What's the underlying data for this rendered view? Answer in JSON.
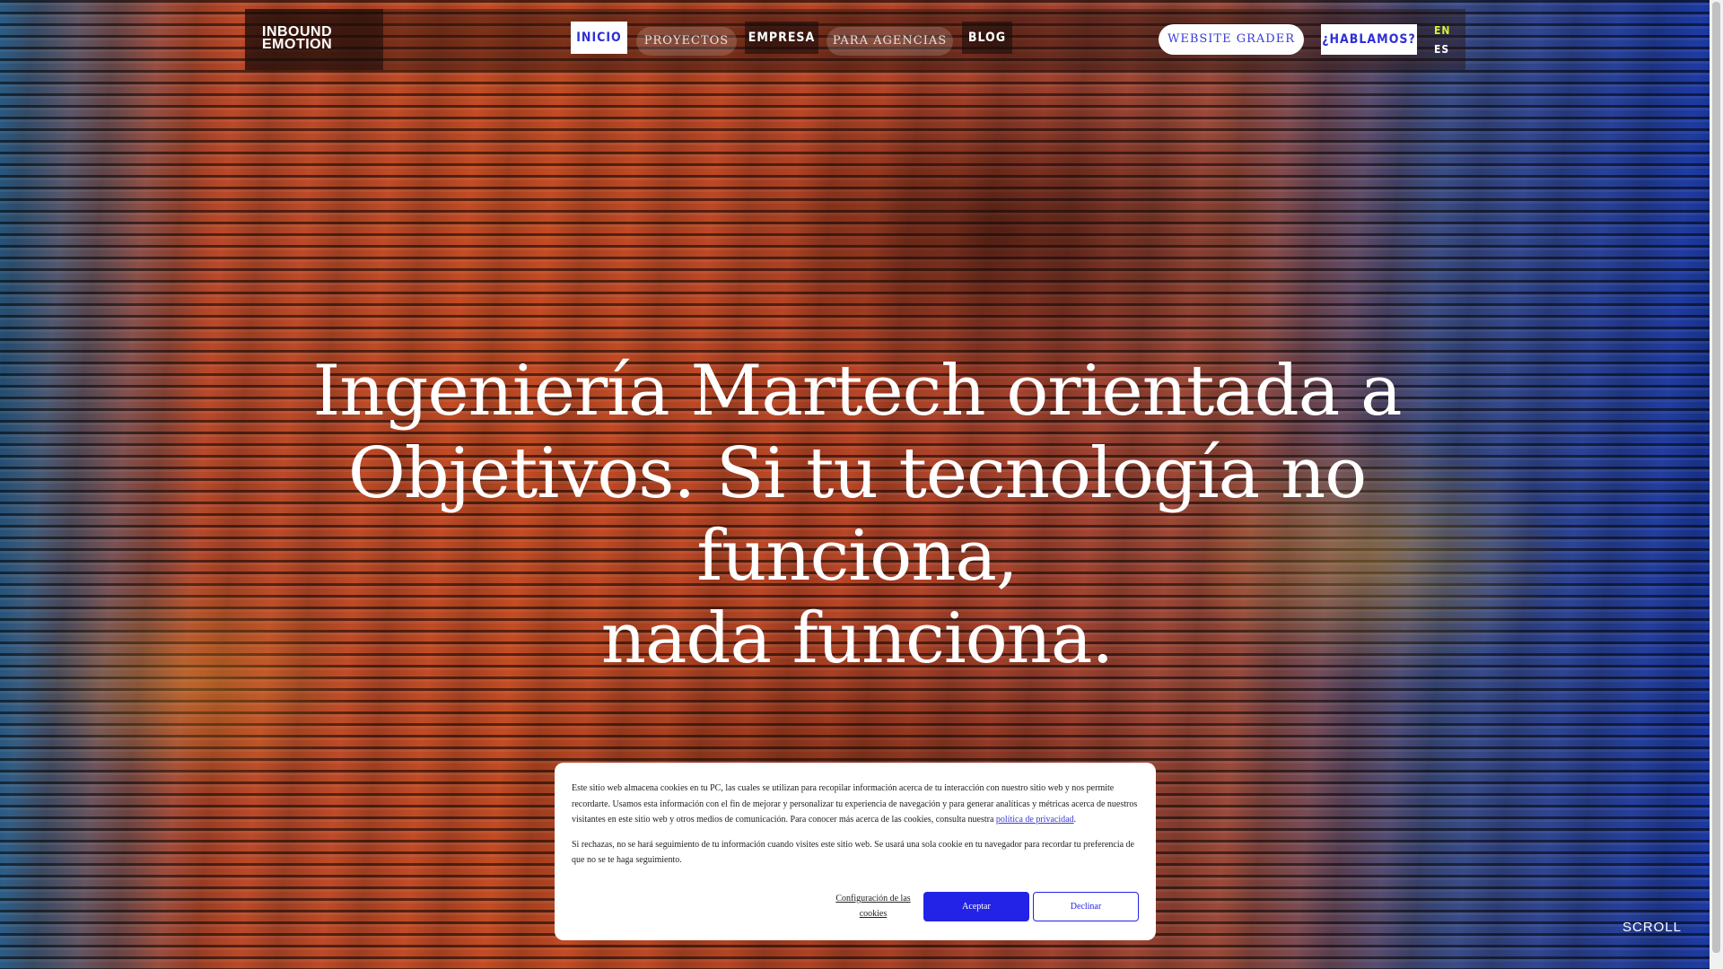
{
  "logo": {
    "line1": "INBOUND",
    "line2": "EMOTION"
  },
  "nav": {
    "items": [
      {
        "label": "INICIO"
      },
      {
        "label": "PROYECTOS"
      },
      {
        "label": "EMPRESA"
      },
      {
        "label": "PARA AGENCIAS"
      },
      {
        "label": "BLOG"
      }
    ],
    "grader_label": "WEBSITE GRADER",
    "contact_label": "¿HABLAMOS?",
    "lang_en": "EN",
    "lang_es": "ES"
  },
  "hero": {
    "line1": "Ingeniería Martech orientada a",
    "line2": "Objetivos. Si tu tecnología no funciona,",
    "line3": "nada funciona.",
    "scroll_label": "SCROLL"
  },
  "cookie": {
    "text1": "Este sitio web almacena cookies en tu PC, las cuales se utilizan para recopilar información acerca de tu interacción con nuestro sitio web y nos permite recordarte. Usamos esta información con el fin de mejorar y personalizar tu experiencia de navegación y para generar analíticas y métricas acerca de nuestros visitantes en este sitio web y otros medios de comunicación. Para conocer más acerca de las cookies, consulta nuestra ",
    "privacy_link": "política de privacidad",
    "text1_end": ".",
    "text2": "Si rechazas, no se hará seguimiento de tu información cuando visites este sitio web. Se usará una sola cookie en tu navegador para recordar tu preferencia de que no se te haga seguimiento.",
    "settings_label": "Configuración de las cookies",
    "accept_label": "Aceptar",
    "decline_label": "Declinar"
  },
  "colors": {
    "accent_blue": "#2323e8",
    "lang_active": "#d9f02a"
  }
}
